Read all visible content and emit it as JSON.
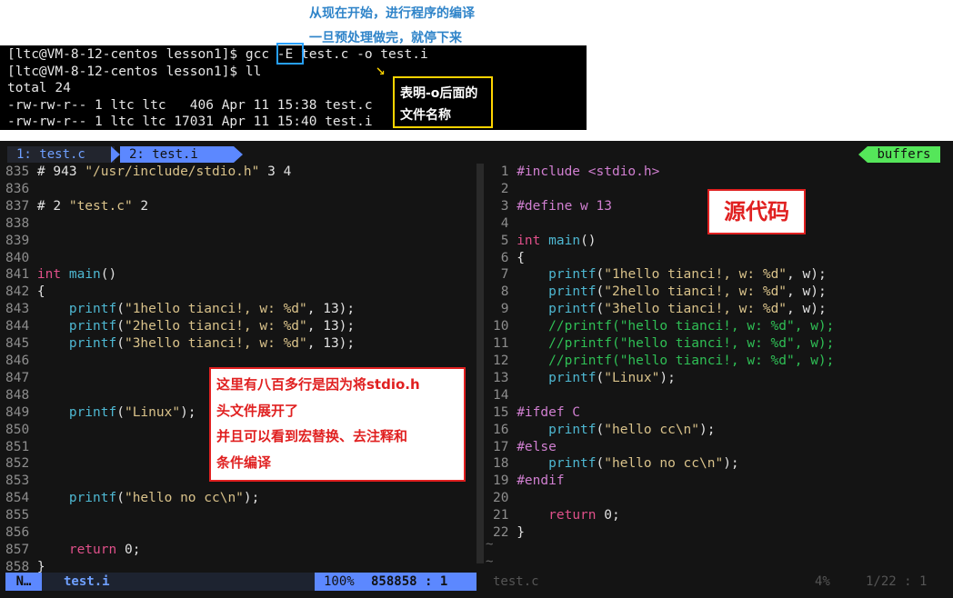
{
  "annotations": {
    "top_line1": "从现在开始，进行程序的编译",
    "top_line2": "一旦预处理做完，就停下来",
    "o_note_line1": "表明-o后面的",
    "o_note_line2": "文件名称",
    "expand_note": [
      "这里有八百多行是因为将stdio.h",
      "头文件展开了",
      "并且可以看到宏替换、去注释和",
      "条件编译"
    ],
    "source_note": "源代码"
  },
  "terminal": {
    "lines": [
      "[ltc@VM-8-12-centos lesson1]$ gcc -E test.c -o test.i",
      "[ltc@VM-8-12-centos lesson1]$ ll",
      "total 24",
      "-rw-rw-r-- 1 ltc ltc   406 Apr 11 15:38 test.c",
      "-rw-rw-r-- 1 ltc ltc 17031 Apr 11 15:40 test.i"
    ]
  },
  "vim": {
    "tabs": [
      "1: test.c",
      "2: test.i"
    ],
    "buffers_label": "buffers",
    "left_lines": [
      {
        "n": "835",
        "t": "# 943 \"/usr/include/stdio.h\" 3 4"
      },
      {
        "n": "836",
        "t": ""
      },
      {
        "n": "837",
        "t": "# 2 \"test.c\" 2"
      },
      {
        "n": "838",
        "t": ""
      },
      {
        "n": "839",
        "t": ""
      },
      {
        "n": "840",
        "t": ""
      },
      {
        "n": "841",
        "t": "int main()"
      },
      {
        "n": "842",
        "t": "{"
      },
      {
        "n": "843",
        "t": "    printf(\"1hello tianci!, w: %d\", 13);"
      },
      {
        "n": "844",
        "t": "    printf(\"2hello tianci!, w: %d\", 13);"
      },
      {
        "n": "845",
        "t": "    printf(\"3hello tianci!, w: %d\", 13);"
      },
      {
        "n": "846",
        "t": ""
      },
      {
        "n": "847",
        "t": ""
      },
      {
        "n": "848",
        "t": ""
      },
      {
        "n": "849",
        "t": "    printf(\"Linux\");"
      },
      {
        "n": "850",
        "t": ""
      },
      {
        "n": "851",
        "t": ""
      },
      {
        "n": "852",
        "t": ""
      },
      {
        "n": "853",
        "t": ""
      },
      {
        "n": "854",
        "t": "    printf(\"hello no cc\\n\");"
      },
      {
        "n": "855",
        "t": ""
      },
      {
        "n": "856",
        "t": ""
      },
      {
        "n": "857",
        "t": "    return 0;"
      },
      {
        "n": "858",
        "t": "}"
      }
    ],
    "right_lines": [
      {
        "n": "1",
        "t": "#include <stdio.h>"
      },
      {
        "n": "2",
        "t": ""
      },
      {
        "n": "3",
        "t": "#define w 13"
      },
      {
        "n": "4",
        "t": ""
      },
      {
        "n": "5",
        "t": "int main()"
      },
      {
        "n": "6",
        "t": "{"
      },
      {
        "n": "7",
        "t": "    printf(\"1hello tianci!, w: %d\", w);"
      },
      {
        "n": "8",
        "t": "    printf(\"2hello tianci!, w: %d\", w);"
      },
      {
        "n": "9",
        "t": "    printf(\"3hello tianci!, w: %d\", w);"
      },
      {
        "n": "10",
        "t": "    //printf(\"hello tianci!, w: %d\", w);"
      },
      {
        "n": "11",
        "t": "    //printf(\"hello tianci!, w: %d\", w);"
      },
      {
        "n": "12",
        "t": "    //printf(\"hello tianci!, w: %d\", w);"
      },
      {
        "n": "13",
        "t": "    printf(\"Linux\");"
      },
      {
        "n": "14",
        "t": ""
      },
      {
        "n": "15",
        "t": "#ifdef C"
      },
      {
        "n": "16",
        "t": "    printf(\"hello cc\\n\");"
      },
      {
        "n": "17",
        "t": "#else"
      },
      {
        "n": "18",
        "t": "    printf(\"hello no cc\\n\");"
      },
      {
        "n": "19",
        "t": "#endif"
      },
      {
        "n": "20",
        "t": ""
      },
      {
        "n": "21",
        "t": "    return 0;"
      },
      {
        "n": "22",
        "t": "}"
      }
    ],
    "left_status": {
      "mode": "N…",
      "file": "test.i",
      "percent": "100%",
      "pos": "858858 :  1"
    },
    "right_status": {
      "file": "test.c",
      "percent": "4%",
      "pos": "1/22 :  1"
    }
  }
}
